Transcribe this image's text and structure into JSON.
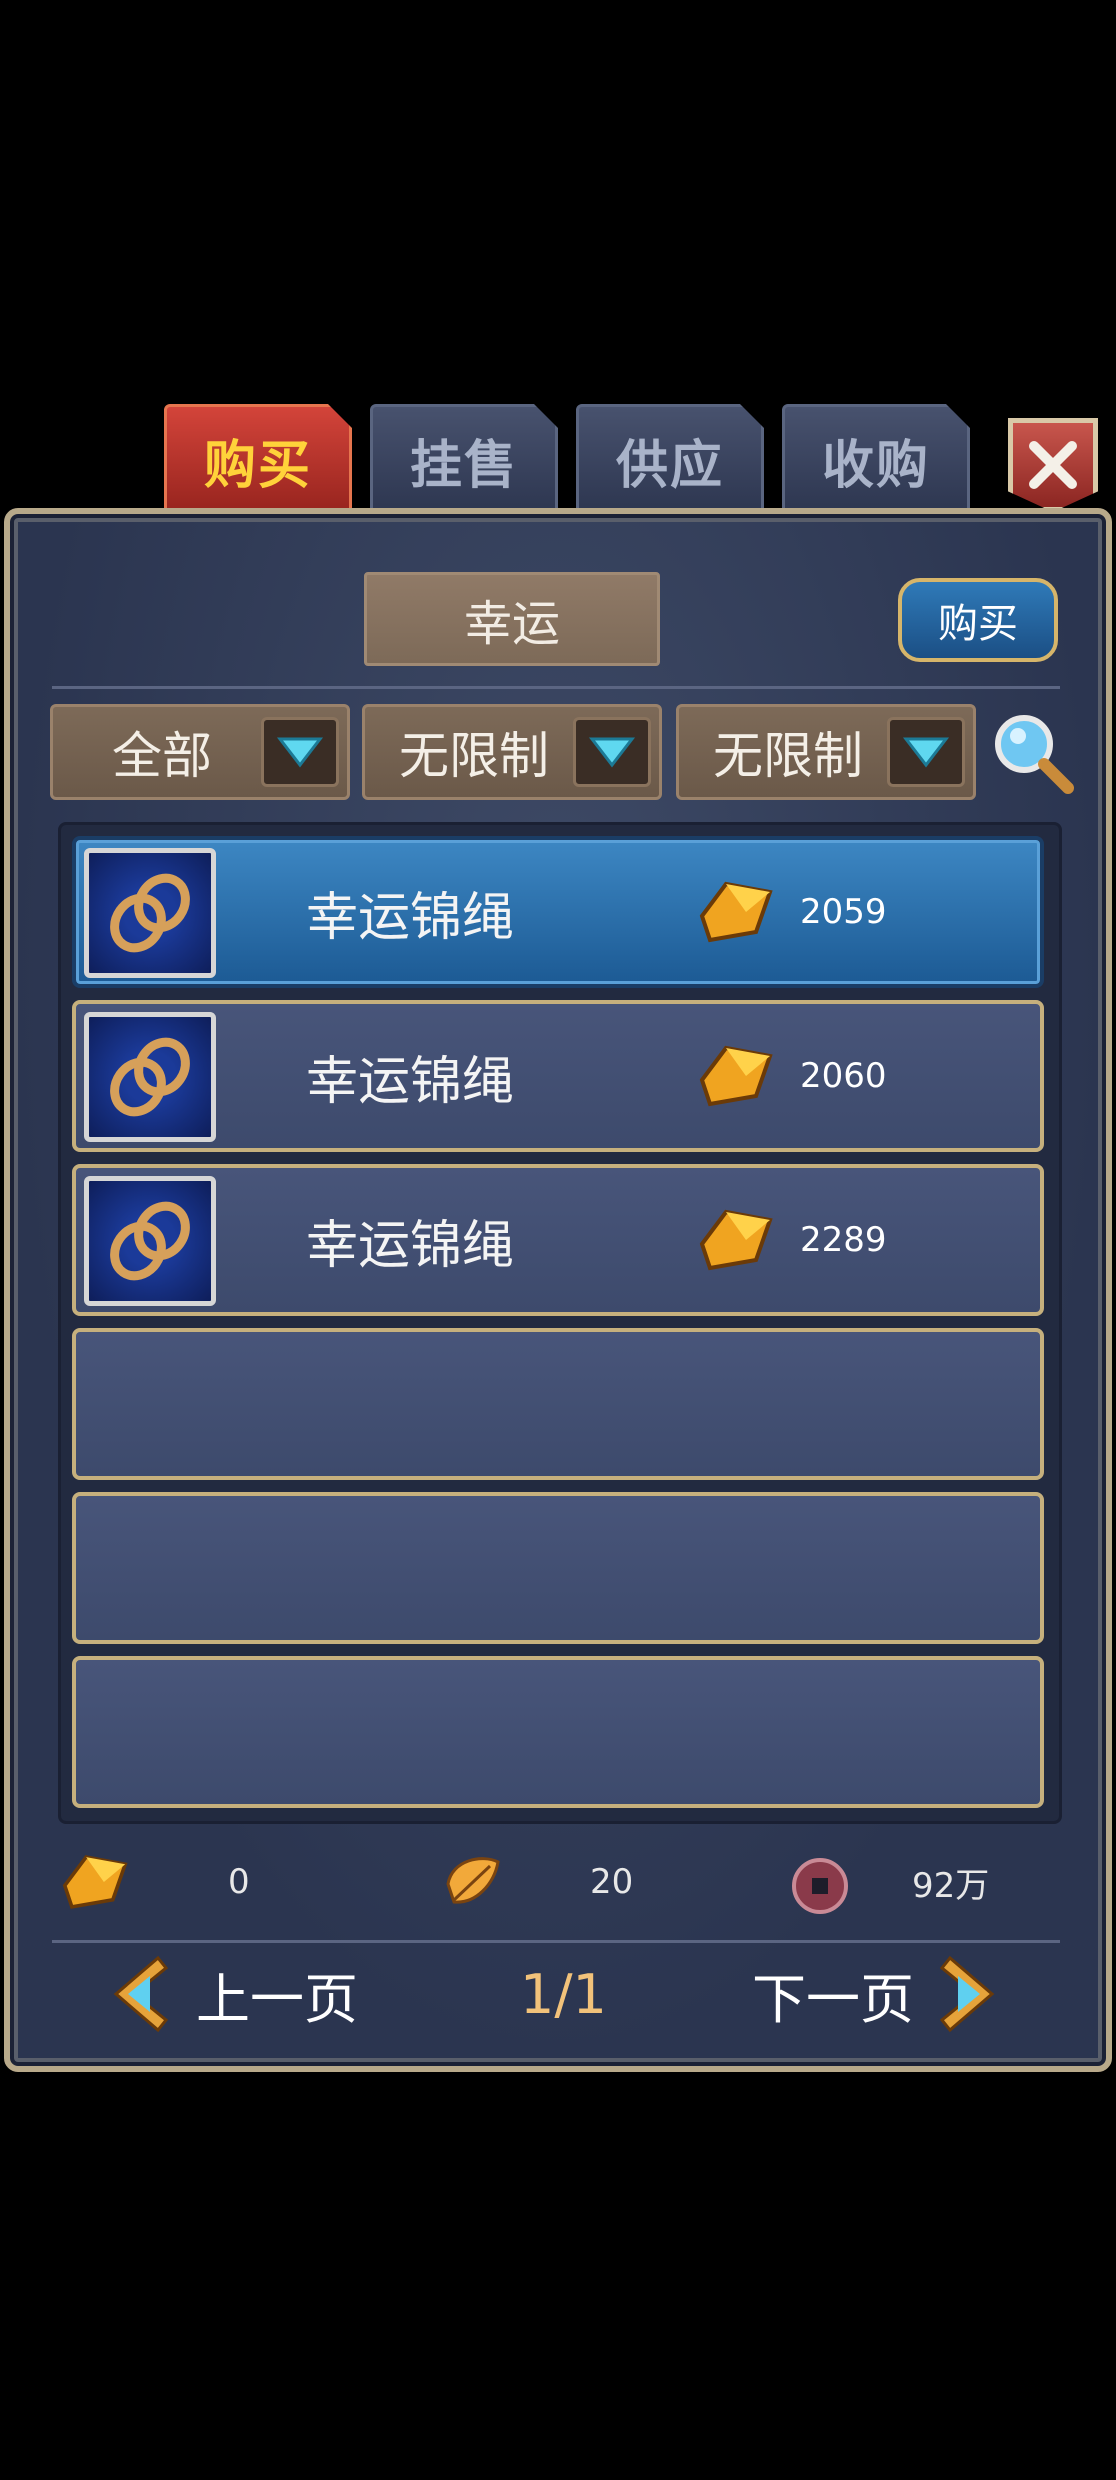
{
  "tabs": [
    {
      "label": "购买",
      "active": true
    },
    {
      "label": "挂售",
      "active": false
    },
    {
      "label": "供应",
      "active": false
    },
    {
      "label": "收购",
      "active": false
    }
  ],
  "category": "幸运",
  "buy_button": "购买",
  "filters": [
    "全部",
    "无限制",
    "无限制"
  ],
  "items": [
    {
      "name": "幸运锦绳",
      "price": "2059",
      "icon": "rope-icon",
      "selected": true
    },
    {
      "name": "幸运锦绳",
      "price": "2060",
      "icon": "rope-icon",
      "selected": false
    },
    {
      "name": "幸运锦绳",
      "price": "2289",
      "icon": "rope-icon",
      "selected": false
    }
  ],
  "currencies": [
    {
      "icon": "gold-ingot-icon",
      "value": "0"
    },
    {
      "icon": "leaf-icon",
      "value": "20"
    },
    {
      "icon": "coin-icon",
      "value": "92万"
    }
  ],
  "pager": {
    "prev": "上一页",
    "page": "1/1",
    "next": "下一页"
  }
}
